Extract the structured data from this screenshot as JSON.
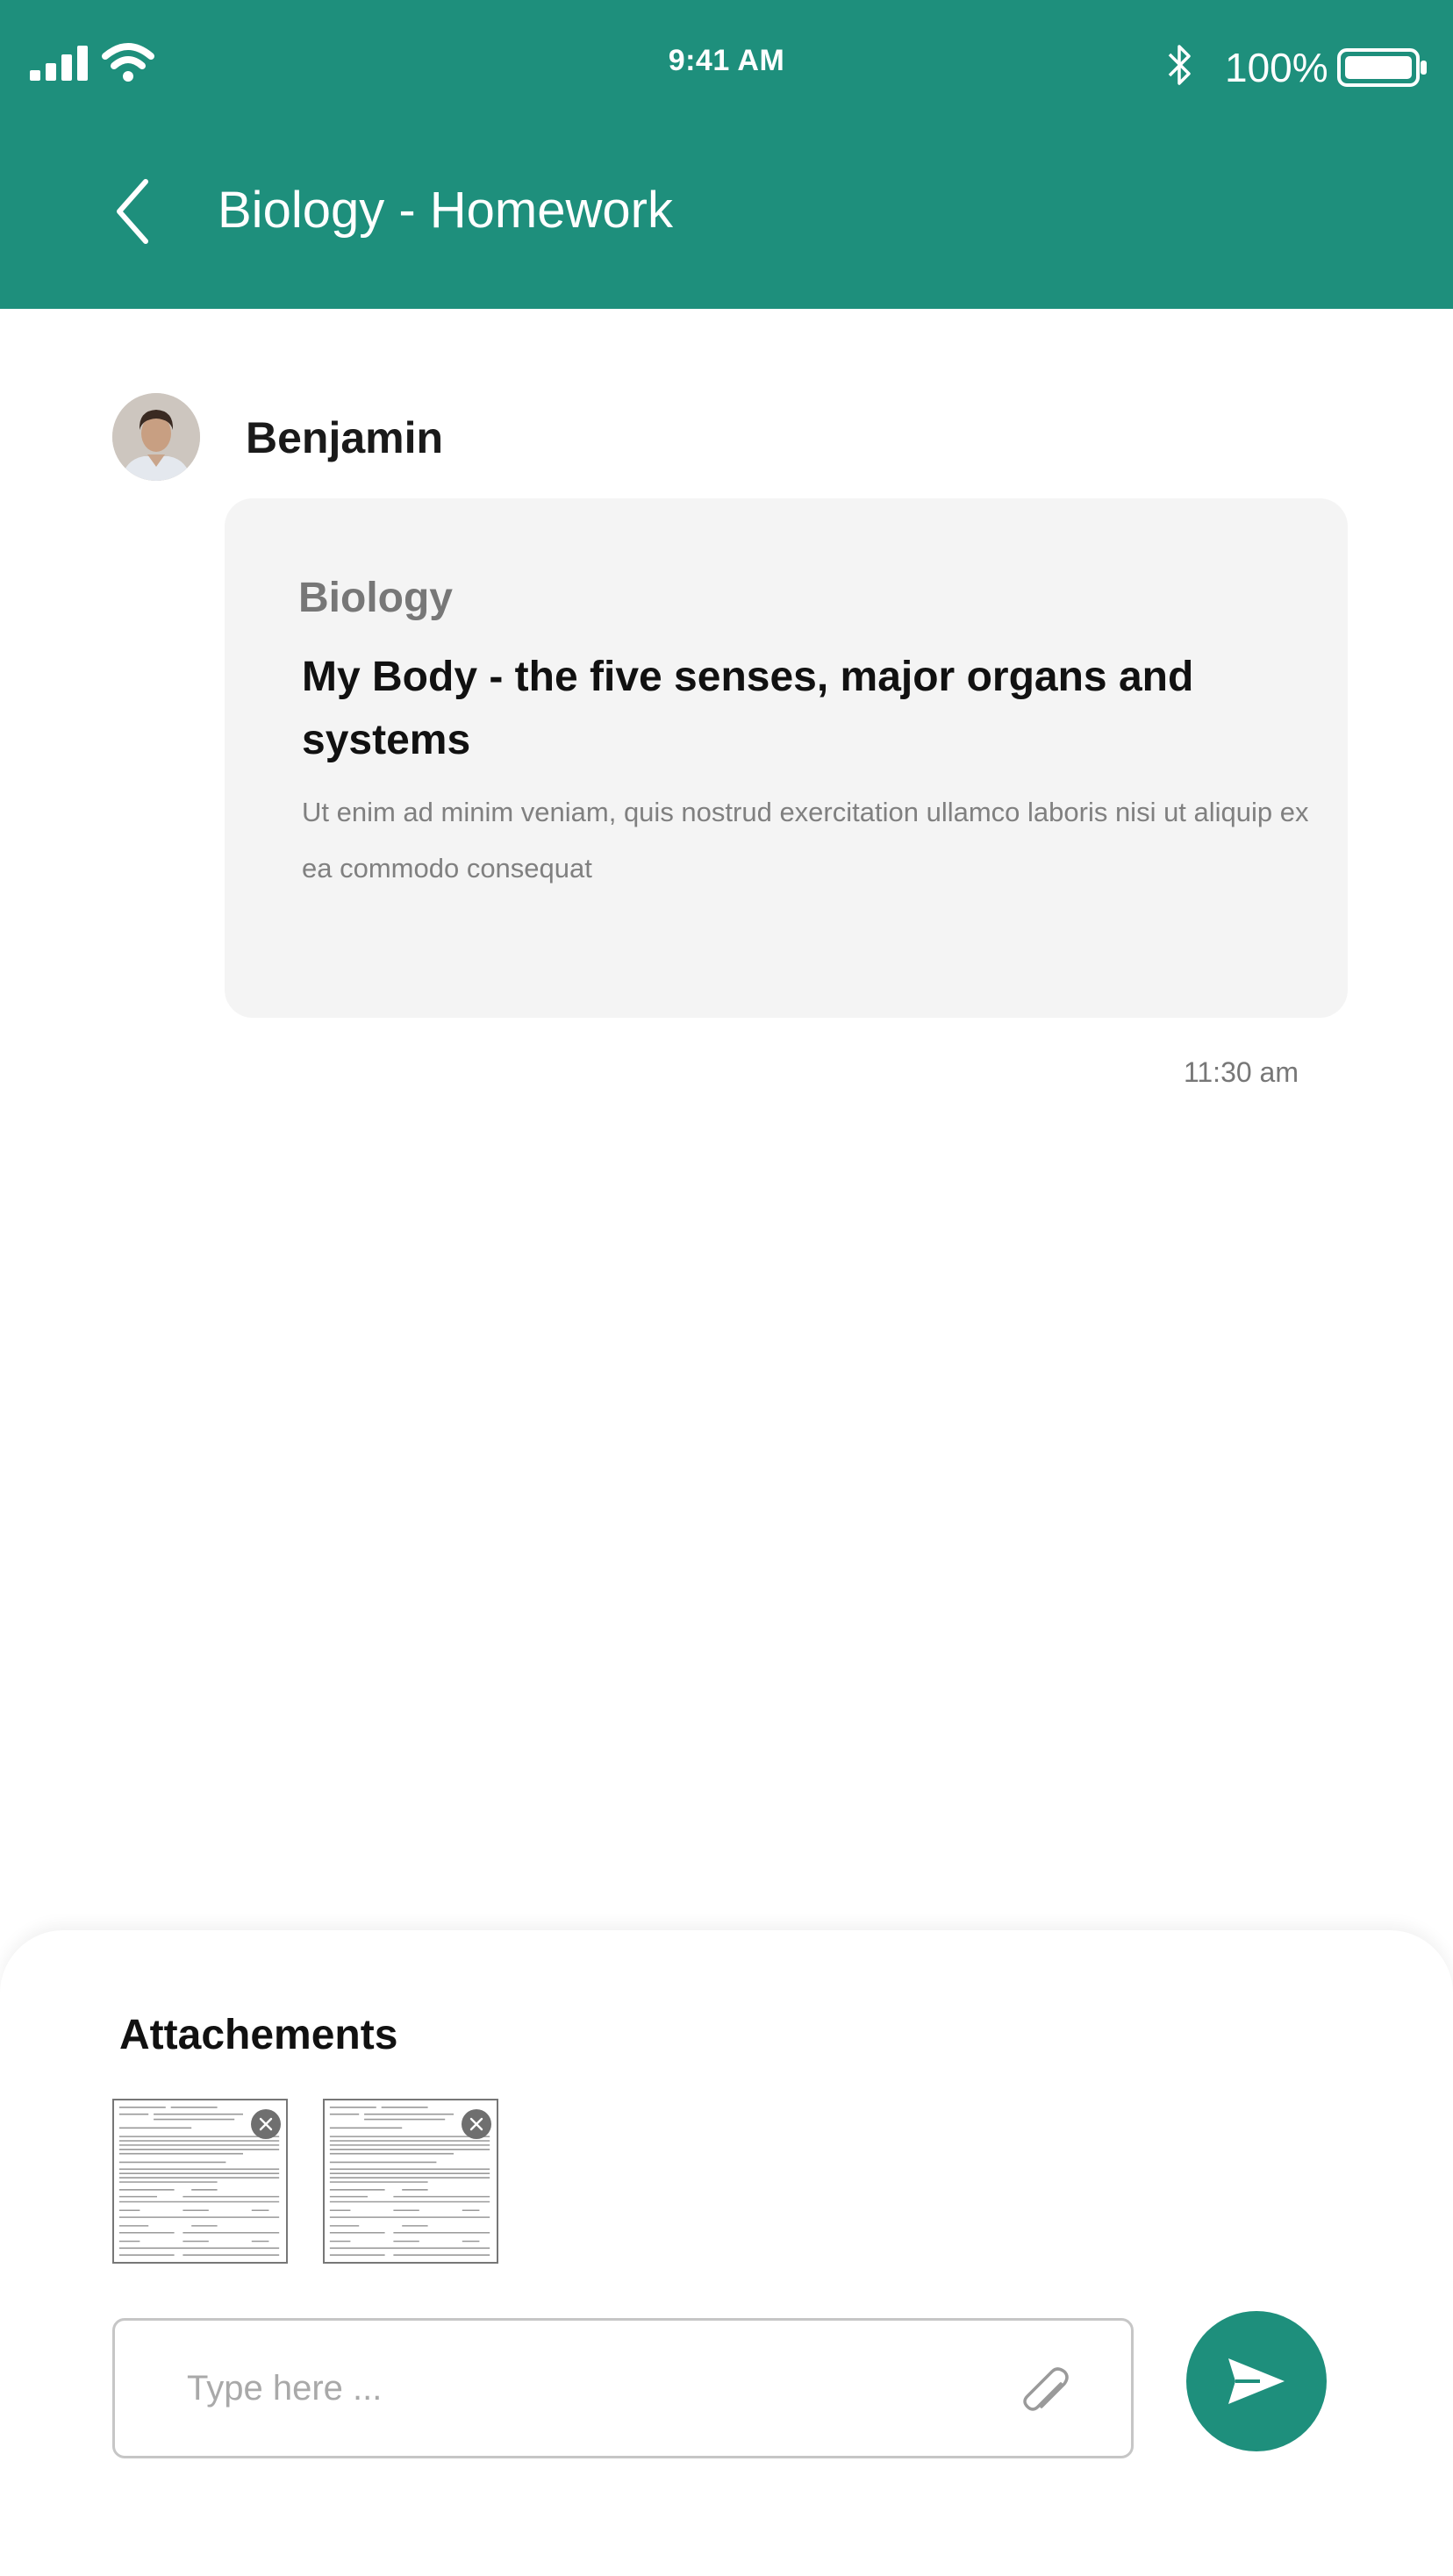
{
  "status_bar": {
    "time": "9:41 AM",
    "battery_percent": "100%",
    "icons": [
      "signal-icon",
      "wifi-icon",
      "bluetooth-icon",
      "battery-icon"
    ]
  },
  "header": {
    "title": "Biology - Homework",
    "back_icon": "chevron-left-icon",
    "background_color": "#1e8f7c"
  },
  "message": {
    "sender": "Benjamin",
    "subject": "Biology",
    "title": "My Body - the five senses, major organs and systems",
    "body": "Ut enim ad minim veniam, quis nostrud exercitation ullamco laboris nisi ut aliquip ex ea commodo consequat",
    "time": "11:30 am"
  },
  "composer": {
    "attachments_title": "Attachements",
    "attachments": [
      {
        "thumbnail": "document-thumbnail",
        "remove_icon": "close-icon"
      },
      {
        "thumbnail": "document-thumbnail",
        "remove_icon": "close-icon"
      }
    ],
    "input_placeholder": "Type here ...",
    "input_value": "",
    "attach_icon": "paperclip-icon",
    "send_icon": "send-icon",
    "accent_color": "#1e8f7c"
  }
}
